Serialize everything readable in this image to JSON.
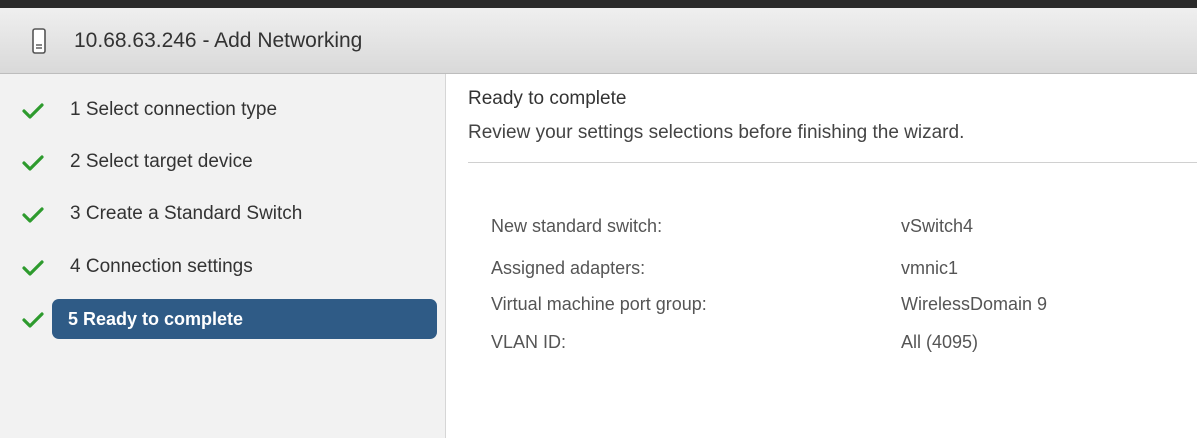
{
  "window": {
    "title": "10.68.63.246 - Add Networking",
    "icon": "host-server-icon"
  },
  "steps": [
    {
      "label": "1  Select connection type",
      "completed": true,
      "active": false
    },
    {
      "label": "2  Select target device",
      "completed": true,
      "active": false
    },
    {
      "label": "3  Create a Standard Switch",
      "completed": true,
      "active": false
    },
    {
      "label": "4  Connection settings",
      "completed": true,
      "active": false
    },
    {
      "label": "5  Ready to complete",
      "completed": true,
      "active": true
    }
  ],
  "content": {
    "heading": "Ready to complete",
    "subheading": "Review your settings selections before finishing the wizard.",
    "summary": [
      {
        "key": "New standard switch:",
        "value": "vSwitch4"
      },
      {
        "key": "Assigned adapters:",
        "value": "vmnic1"
      },
      {
        "key": "Virtual machine port group:",
        "value": "WirelessDomain 9"
      },
      {
        "key": "VLAN ID:",
        "value": "All (4095)"
      }
    ]
  },
  "colors": {
    "check": "#2e9b2e",
    "active_step_bg": "#2f5b86",
    "nav_bg": "#f2f2f2"
  }
}
